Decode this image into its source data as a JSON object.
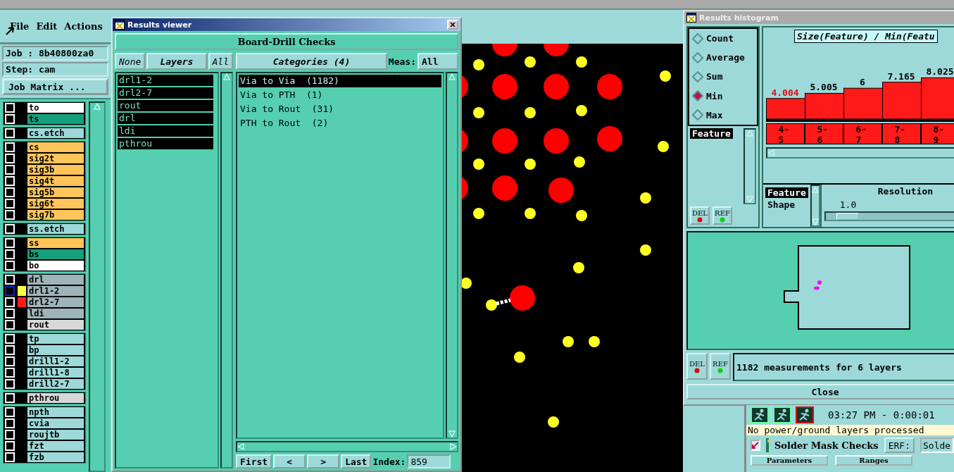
{
  "app": {
    "menu": [
      "File",
      "Edit",
      "Actions"
    ],
    "job": "Job : 8b40800za0",
    "step": "Step: cam",
    "job_matrix_button": "Job Matrix ..."
  },
  "layer_groups": [
    {
      "layers": [
        {
          "name": "to",
          "color": "#ffffff",
          "checked": false,
          "selected": false
        },
        {
          "name": "ts",
          "color": "#14a07c",
          "checked": false,
          "selected": false
        }
      ]
    },
    {
      "layers": [
        {
          "name": "cs.etch",
          "color": "#9ed9d9",
          "checked": false,
          "selected": false
        }
      ]
    },
    {
      "layers": [
        {
          "name": "cs",
          "color": "#ffc55a",
          "checked": false,
          "selected": false
        },
        {
          "name": "sig2t",
          "color": "#ffc55a",
          "checked": false,
          "selected": false
        },
        {
          "name": "sig3b",
          "color": "#ffc55a",
          "checked": false,
          "selected": false
        },
        {
          "name": "sig4t",
          "color": "#ffc55a",
          "checked": false,
          "selected": false
        },
        {
          "name": "sig5b",
          "color": "#ffc55a",
          "checked": false,
          "selected": false
        },
        {
          "name": "sig6t",
          "color": "#ffc55a",
          "checked": false,
          "selected": false
        },
        {
          "name": "sig7b",
          "color": "#ffc55a",
          "checked": false,
          "selected": false
        }
      ]
    },
    {
      "layers": [
        {
          "name": "ss.etch",
          "color": "#9ed9d9",
          "checked": false,
          "selected": false
        }
      ]
    },
    {
      "layers": [
        {
          "name": "ss",
          "color": "#ffc55a",
          "checked": false,
          "selected": false
        },
        {
          "name": "bs",
          "color": "#14a07c",
          "checked": false,
          "selected": false
        },
        {
          "name": "bo",
          "color": "#ffffff",
          "checked": false,
          "selected": false
        }
      ]
    },
    {
      "layers": [
        {
          "name": "drl",
          "color": "#9fb4b8",
          "checked": false,
          "selected": false
        },
        {
          "name": "drl1-2",
          "color": "#9fb4b8",
          "checked": false,
          "selected": true,
          "swatch": {
            "color": "#ffff44"
          }
        },
        {
          "name": "drl2-7",
          "color": "#9fb4b8",
          "checked": false,
          "selected": false,
          "swatch": {
            "color": "#ff1a1a"
          }
        },
        {
          "name": "ldi",
          "color": "#9fb4b8",
          "checked": false,
          "selected": false
        },
        {
          "name": "rout",
          "color": "#d8d8d8",
          "checked": false,
          "selected": false
        }
      ]
    },
    {
      "layers": [
        {
          "name": "tp",
          "color": "#9ed9d9",
          "checked": false,
          "selected": false
        },
        {
          "name": "bp",
          "color": "#9ed9d9",
          "checked": false,
          "selected": false
        },
        {
          "name": "drill1-2",
          "color": "#9ed9d9",
          "checked": false,
          "selected": false
        },
        {
          "name": "drill1-8",
          "color": "#9ed9d9",
          "checked": false,
          "selected": false
        },
        {
          "name": "drill2-7",
          "color": "#9ed9d9",
          "checked": false,
          "selected": false
        }
      ]
    },
    {
      "layers": [
        {
          "name": "pthrou",
          "color": "#d8d8d8",
          "checked": false,
          "selected": false
        }
      ]
    },
    {
      "layers": [
        {
          "name": "npth",
          "color": "#9ed9d9",
          "checked": false,
          "selected": false
        },
        {
          "name": "cvia",
          "color": "#9ed9d9",
          "checked": false,
          "selected": false
        },
        {
          "name": "roujtb",
          "color": "#9ed9d9",
          "checked": false,
          "selected": false
        },
        {
          "name": "fzt",
          "color": "#9ed9d9",
          "checked": false,
          "selected": false
        },
        {
          "name": "fzb",
          "color": "#9ed9d9",
          "checked": false,
          "selected": false
        }
      ]
    }
  ],
  "results_viewer": {
    "title": "Results viewer",
    "header": "Board-Drill Checks",
    "layer_buttons": [
      "None",
      "Layers",
      "All"
    ],
    "layers": [
      {
        "name": "drl1-2",
        "selected": true
      },
      {
        "name": "drl2-7",
        "selected": true
      },
      {
        "name": "rout",
        "selected": true
      },
      {
        "name": "drl",
        "selected": true
      },
      {
        "name": "ldi",
        "selected": true
      },
      {
        "name": "pthrou",
        "selected": true
      }
    ],
    "categories_button": "Categories (4)",
    "meas_label": "Meas:",
    "meas_value": "All",
    "categories": [
      {
        "label": "Via to Via  (1182)",
        "selected": true
      },
      {
        "label": "Via to PTH  (1)",
        "selected": false
      },
      {
        "label": "Via to Rout  (31)",
        "selected": false
      },
      {
        "label": "PTH to Rout  (2)",
        "selected": false
      }
    ],
    "nav_buttons": [
      "First",
      "<",
      ">",
      "Last"
    ],
    "index_label": "Index:",
    "index_value": "859"
  },
  "histogram": {
    "title": "Results histogram",
    "modes": [
      {
        "label": "Count",
        "selected": false
      },
      {
        "label": "Average",
        "selected": false
      },
      {
        "label": "Sum",
        "selected": false
      },
      {
        "label": "Min",
        "selected": true
      },
      {
        "label": "Max",
        "selected": false
      }
    ],
    "feature_list": [
      {
        "label": "Feature",
        "selected": true
      }
    ],
    "panel_buttons": [
      "DEL",
      "REF"
    ],
    "chart_title": "Size(Feature) / Min(Featu",
    "chart_data": {
      "type": "bar",
      "categories": [
        "4-5",
        "5-6",
        "6-7",
        "7-8",
        "8-9"
      ],
      "values": [
        4.004,
        5.005,
        6,
        7.165,
        8.025
      ],
      "data_labels": true
    },
    "highlighted_bars": [
      true,
      false,
      false,
      false,
      false
    ],
    "attributes": [
      {
        "label": "Feature",
        "selected": true
      },
      {
        "label": "Shape",
        "selected": false
      }
    ],
    "resolution_label": "Resolution",
    "resolution_value": "1.0",
    "resolution_slider": {
      "level": 0.05
    },
    "status_buttons": [
      "DEL",
      "REF"
    ],
    "status": "1182 measurements for 6 layers",
    "close_button": "Close"
  },
  "checks_panel": {
    "time": "03:27 PM - 0:00:01",
    "message": "No power/ground layers processed",
    "check": {
      "label": "Solder Mask Checks",
      "checked": true
    },
    "erf_button": "ERF:",
    "erf_value": "Solde",
    "buttons": [
      "Parameters",
      "Ranges"
    ]
  }
}
